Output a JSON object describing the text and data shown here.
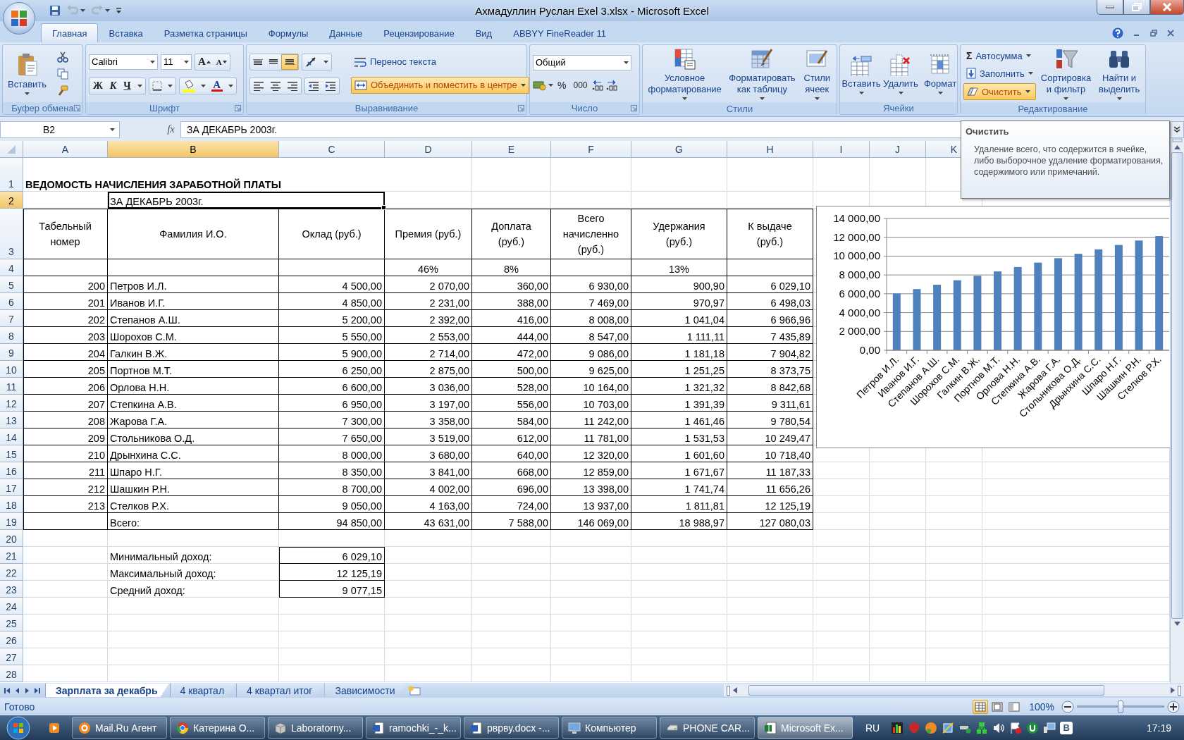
{
  "window": {
    "title": "Ахмадуллин Руслан Exel 3.xlsx - Microsoft Excel"
  },
  "quick_access": [
    {
      "kind": "save",
      "disabled": false
    },
    {
      "kind": "undo",
      "disabled": true
    },
    {
      "kind": "redo",
      "disabled": true
    }
  ],
  "ribbon": {
    "tabs": [
      {
        "label": "Главная",
        "selected": true
      },
      {
        "label": "Вставка",
        "selected": false
      },
      {
        "label": "Разметка страницы",
        "selected": false
      },
      {
        "label": "Формулы",
        "selected": false
      },
      {
        "label": "Данные",
        "selected": false
      },
      {
        "label": "Рецензирование",
        "selected": false
      },
      {
        "label": "Вид",
        "selected": false
      },
      {
        "label": "ABBYY FineReader 11",
        "selected": false
      }
    ],
    "clipboard": {
      "label": "Буфер обмена",
      "paste": "Вставить",
      "launcher": true
    },
    "font": {
      "label": "Шрифт",
      "family": "Calibri",
      "size": "11",
      "grow": "A",
      "shrink": "A",
      "styles": [
        "Ж",
        "К",
        "Ч"
      ],
      "color_letter": "A",
      "launcher": true
    },
    "alignment": {
      "label": "Выравнивание",
      "vertical": [
        {
          "selected": false
        },
        {
          "selected": false
        },
        {
          "selected": true
        }
      ],
      "wrap": "Перенос текста",
      "merge": {
        "label": "Объединить и поместить в центре",
        "selected": true
      },
      "launcher": true
    },
    "number": {
      "label": "Число",
      "format": "Общий",
      "percent": "%",
      "thousands": "000",
      "launcher": true
    },
    "styles": {
      "label": "Стили",
      "buttons": [
        {
          "kind": "conditional",
          "label": "Условное форматирование"
        },
        {
          "kind": "table",
          "label": "Форматировать как таблицу"
        },
        {
          "kind": "cell_styles",
          "label": "Стили ячеек"
        }
      ]
    },
    "cells": {
      "label": "Ячейки",
      "buttons": [
        {
          "kind": "insert",
          "label": "Вставить"
        },
        {
          "kind": "delete",
          "label": "Удалить"
        },
        {
          "kind": "format",
          "label": "Формат"
        }
      ]
    },
    "editing": {
      "label": "Редактирование",
      "small": [
        {
          "kind": "sum",
          "symbol": "Σ",
          "label": "Автосумма",
          "selected": false
        },
        {
          "kind": "fill",
          "label": "Заполнить",
          "selected": false
        },
        {
          "kind": "clear",
          "label": "Очистить",
          "selected": true
        }
      ],
      "large": [
        {
          "kind": "sort",
          "label": "Сортировка и фильтр"
        },
        {
          "kind": "find",
          "label": "Найти и выделить"
        }
      ]
    }
  },
  "formula_bar": {
    "name_box": "B2",
    "fx": "fx",
    "formula": "ЗА ДЕКАБРЬ 2003г."
  },
  "sheet": {
    "column_headers": [
      {
        "label": "A",
        "selected": false
      },
      {
        "label": "B",
        "selected": true
      },
      {
        "label": "C",
        "selected": false
      },
      {
        "label": "D",
        "selected": false
      },
      {
        "label": "E",
        "selected": false
      },
      {
        "label": "F",
        "selected": false
      },
      {
        "label": "G",
        "selected": false
      },
      {
        "label": "H",
        "selected": false
      },
      {
        "label": "I",
        "selected": false
      },
      {
        "label": "J",
        "selected": false
      },
      {
        "label": "K",
        "selected": false
      }
    ],
    "row_numbers": [
      {
        "label": "1",
        "selected": false
      },
      {
        "label": "2",
        "selected": true
      },
      {
        "label": "3",
        "selected": false
      },
      {
        "label": "4",
        "selected": false
      },
      {
        "label": "5",
        "selected": false
      },
      {
        "label": "6",
        "selected": false
      },
      {
        "label": "7",
        "selected": false
      },
      {
        "label": "8",
        "selected": false
      },
      {
        "label": "9",
        "selected": false
      },
      {
        "label": "10",
        "selected": false
      },
      {
        "label": "11",
        "selected": false
      },
      {
        "label": "12",
        "selected": false
      },
      {
        "label": "13",
        "selected": false
      },
      {
        "label": "14",
        "selected": false
      },
      {
        "label": "15",
        "selected": false
      },
      {
        "label": "16",
        "selected": false
      },
      {
        "label": "17",
        "selected": false
      },
      {
        "label": "18",
        "selected": false
      },
      {
        "label": "19",
        "selected": false
      },
      {
        "label": "20",
        "selected": false
      },
      {
        "label": "21",
        "selected": false
      },
      {
        "label": "22",
        "selected": false
      },
      {
        "label": "23",
        "selected": false
      },
      {
        "label": "24",
        "selected": false
      },
      {
        "label": "25",
        "selected": false
      },
      {
        "label": "26",
        "selected": false
      },
      {
        "label": "27",
        "selected": false
      },
      {
        "label": "28",
        "selected": false
      }
    ],
    "title": "ВЕДОМОСТЬ НАЧИСЛЕНИЯ ЗАРАБОТНОЙ ПЛАТЫ",
    "subtitle": "ЗА ДЕКАБРЬ 2003г.",
    "header": [
      "Табельный номер",
      "Фамилия И.О.",
      "Оклад (руб.)",
      "Премия (руб.)",
      "Доплата (руб.)",
      "Всего начисленно (руб.)",
      "Удержания (руб.)",
      "К выдаче (руб.)"
    ],
    "rates": {
      "bonus": "46%",
      "extra": "8%",
      "deduction": "13%"
    },
    "rows": [
      [
        "200",
        "Петров И.Л.",
        "4 500,00",
        "2 070,00",
        "360,00",
        "6 930,00",
        "900,90",
        "6 029,10"
      ],
      [
        "201",
        "Иванов И.Г.",
        "4 850,00",
        "2 231,00",
        "388,00",
        "7 469,00",
        "970,97",
        "6 498,03"
      ],
      [
        "202",
        "Степанов А.Ш.",
        "5 200,00",
        "2 392,00",
        "416,00",
        "8 008,00",
        "1 041,04",
        "6 966,96"
      ],
      [
        "203",
        "Шорохов С.М.",
        "5 550,00",
        "2 553,00",
        "444,00",
        "8 547,00",
        "1 111,11",
        "7 435,89"
      ],
      [
        "204",
        "Галкин В.Ж.",
        "5 900,00",
        "2 714,00",
        "472,00",
        "9 086,00",
        "1 181,18",
        "7 904,82"
      ],
      [
        "205",
        "Портнов М.Т.",
        "6 250,00",
        "2 875,00",
        "500,00",
        "9 625,00",
        "1 251,25",
        "8 373,75"
      ],
      [
        "206",
        "Орлова Н.Н.",
        "6 600,00",
        "3 036,00",
        "528,00",
        "10 164,00",
        "1 321,32",
        "8 842,68"
      ],
      [
        "207",
        "Степкина А.В.",
        "6 950,00",
        "3 197,00",
        "556,00",
        "10 703,00",
        "1 391,39",
        "9 311,61"
      ],
      [
        "208",
        "Жарова Г.А.",
        "7 300,00",
        "3 358,00",
        "584,00",
        "11 242,00",
        "1 461,46",
        "9 780,54"
      ],
      [
        "209",
        "Стольникова О.Д.",
        "7 650,00",
        "3 519,00",
        "612,00",
        "11 781,00",
        "1 531,53",
        "10 249,47"
      ],
      [
        "210",
        "Дрынхина С.С.",
        "8 000,00",
        "3 680,00",
        "640,00",
        "12 320,00",
        "1 601,60",
        "10 718,40"
      ],
      [
        "211",
        "Шпаро Н.Г.",
        "8 350,00",
        "3 841,00",
        "668,00",
        "12 859,00",
        "1 671,67",
        "11 187,33"
      ],
      [
        "212",
        "Шашкин Р.Н.",
        "8 700,00",
        "4 002,00",
        "696,00",
        "13 398,00",
        "1 741,74",
        "11 656,26"
      ],
      [
        "213",
        "Стелков Р.Х.",
        "9 050,00",
        "4 163,00",
        "724,00",
        "13 937,00",
        "1 811,81",
        "12 125,19"
      ]
    ],
    "total": {
      "label": "Всего:",
      "values": [
        "94 850,00",
        "43 631,00",
        "7 588,00",
        "146 069,00",
        "18 988,97",
        "127 080,03"
      ]
    },
    "summary": [
      {
        "label": "Минимальный доход:",
        "value": "6 029,10"
      },
      {
        "label": "Максимальный доход:",
        "value": "12 125,19"
      },
      {
        "label": "Средний доход:",
        "value": "9 077,15"
      }
    ],
    "chart": {
      "chart_data": {
        "type": "bar",
        "categories": [
          "Петров И.Л.",
          "Иванов И.Г.",
          "Степанов А.Ш.",
          "Шорохов С.М.",
          "Галкин В.Ж.",
          "Портнов М.Т.",
          "Орлова Н.Н.",
          "Степкина А.В.",
          "Жарова Г.А.",
          "Стольникова О.Д.",
          "Дрынхина С.С.",
          "Шпаро Н.Г.",
          "Шашкин Р.Н.",
          "Стелков Р.Х."
        ],
        "series": [
          {
            "color": "#4f81bd",
            "values": [
              6029,
              6498,
              6967,
              7436,
              7905,
              8374,
              8843,
              9312,
              9781,
              10249,
              10718,
              11187,
              11656,
              12125
            ]
          }
        ],
        "ylim": [
          0,
          14000
        ],
        "grid": true,
        "yticks": [
          {
            "value": 0,
            "label": "0,00"
          },
          {
            "value": 2000,
            "label": "2 000,00"
          },
          {
            "value": 4000,
            "label": "4 000,00"
          },
          {
            "value": 6000,
            "label": "6 000,00"
          },
          {
            "value": 8000,
            "label": "8 000,00"
          },
          {
            "value": 10000,
            "label": "10 000,00"
          },
          {
            "value": 12000,
            "label": "12 000,00"
          },
          {
            "value": 14000,
            "label": "14 000,00"
          }
        ]
      }
    }
  },
  "tooltip": {
    "title": "Очистить",
    "text": "Удаление всего, что содержится в ячейке, либо выборочное удаление форматирования, содержимого или примечаний."
  },
  "sheet_tabs": [
    {
      "label": "Зарплата за декабрь",
      "selected": true
    },
    {
      "label": "4 квартал",
      "selected": false
    },
    {
      "label": "4 квартал итог",
      "selected": false
    },
    {
      "label": "Зависимости",
      "selected": false
    }
  ],
  "status_bar": {
    "status": "Готово",
    "views": [
      {
        "selected": true
      },
      {
        "selected": false
      },
      {
        "selected": false
      }
    ],
    "zoom": "100%",
    "zoom_slider": {
      "level": 0.5
    }
  },
  "taskbar": {
    "buttons": [
      {
        "kind": "mail",
        "label": "Mail.Ru Агент",
        "selected": false
      },
      {
        "kind": "browser",
        "label": "Катерина О...",
        "selected": false
      },
      {
        "kind": "archive",
        "label": "Laboratorny...",
        "selected": false
      },
      {
        "kind": "document",
        "label": "ramochki_-_k...",
        "selected": false
      },
      {
        "kind": "document",
        "label": "рврву.docx -...",
        "selected": false
      },
      {
        "kind": "computer",
        "label": "Компьютер",
        "selected": false
      },
      {
        "kind": "drive",
        "label": "PHONE CAR...",
        "selected": false
      },
      {
        "kind": "spreadsheet",
        "label": "Microsoft Ex...",
        "selected": true
      }
    ],
    "language": "RU",
    "badge": "В",
    "clock": "17:19"
  }
}
